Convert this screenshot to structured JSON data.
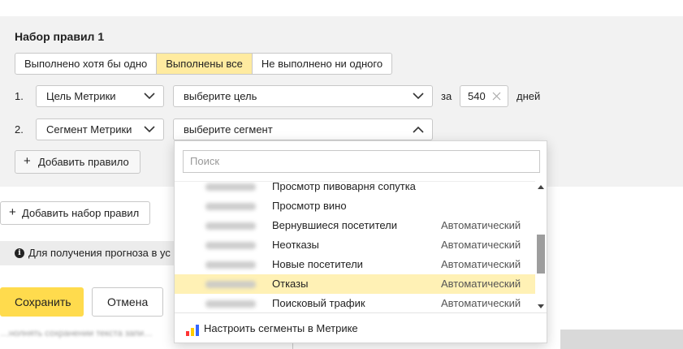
{
  "ruleset": {
    "title": "Набор правил 1",
    "modes": [
      {
        "label": "Выполнено хотя бы одно",
        "active": false
      },
      {
        "label": "Выполнены все",
        "active": true
      },
      {
        "label": "Не выполнено ни одного",
        "active": false
      }
    ],
    "rows": [
      {
        "num": "1.",
        "type": "Цель Метрики",
        "target": "выберите цель",
        "for_label": "за",
        "days": "540",
        "days_label": "дней"
      },
      {
        "num": "2.",
        "type": "Сегмент Метрики",
        "target": "выберите сегмент"
      }
    ],
    "add_rule_label": "Добавить правило",
    "add_ruleset_label": "Добавить набор правил"
  },
  "info": {
    "text": "Для получения прогноза в ус"
  },
  "actions": {
    "save": "Сохранить",
    "cancel": "Отмена"
  },
  "footer": {
    "faded_text": "…нолнять сохранении текста запи…"
  },
  "dropdown": {
    "search_placeholder": "Поиск",
    "options": [
      {
        "name": "Просмотр пивоварня сопутка",
        "kind": ""
      },
      {
        "name": "Просмотр вино",
        "kind": ""
      },
      {
        "name": "Вернувшиеся посетители",
        "kind": "Автоматический"
      },
      {
        "name": "Неотказы",
        "kind": "Автоматический"
      },
      {
        "name": "Новые посетители",
        "kind": "Автоматический"
      },
      {
        "name": "Отказы",
        "kind": "Автоматический",
        "highlighted": true
      },
      {
        "name": "Поисковый трафик",
        "kind": "Автоматический"
      }
    ],
    "footer_link": "Настроить сегменты в Метрике"
  },
  "colors": {
    "accent_yellow": "#ffdb4d",
    "active_segment": "#ffeba0",
    "highlight_row": "#fff1b5"
  }
}
